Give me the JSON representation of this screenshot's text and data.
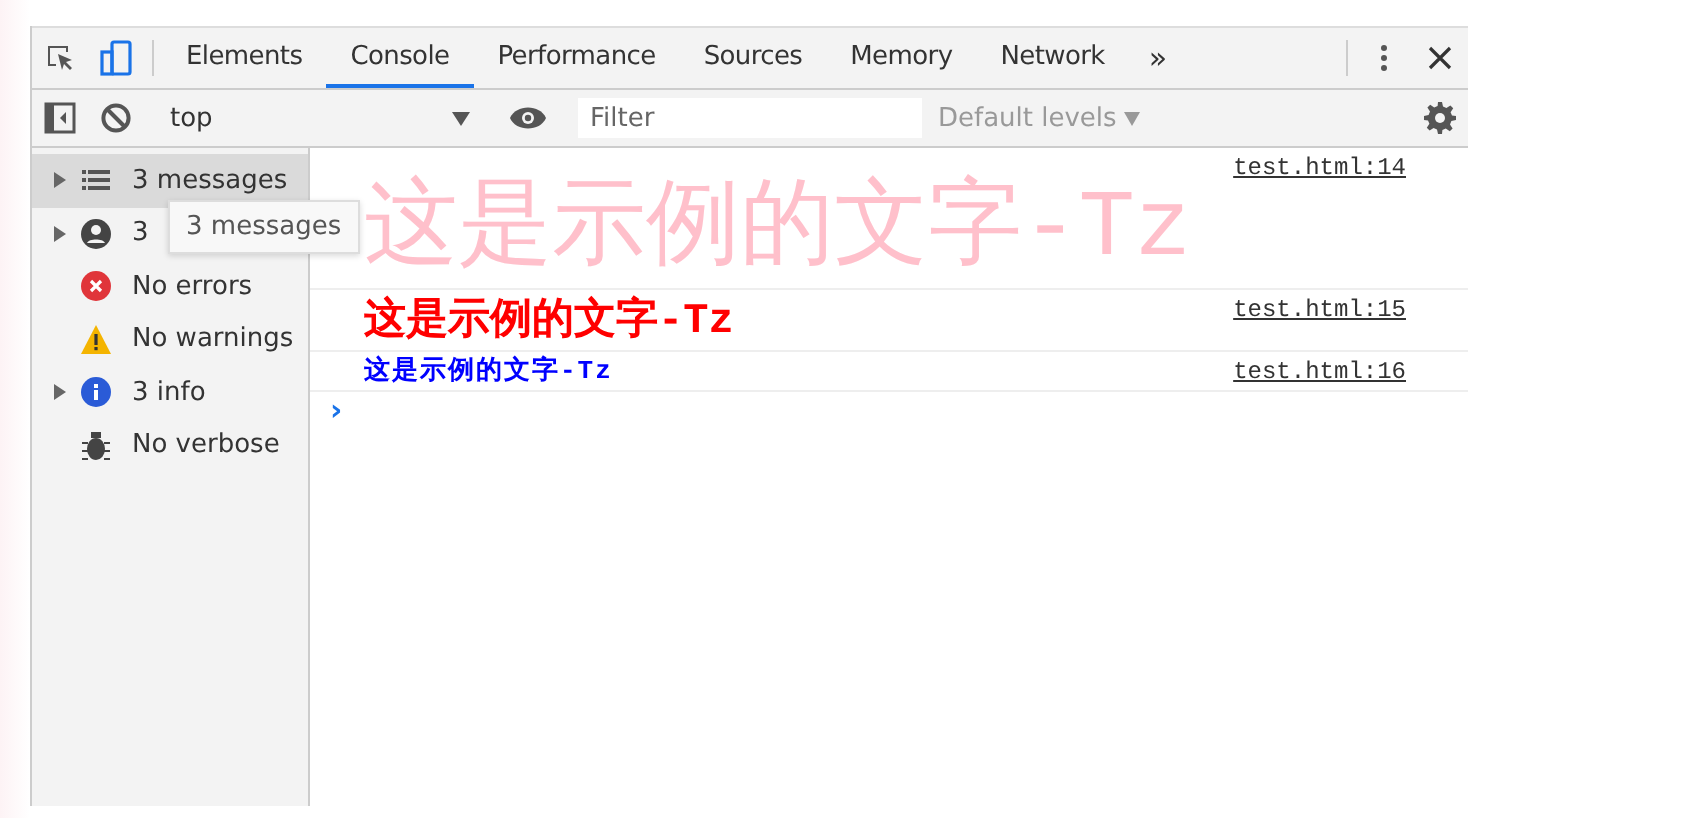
{
  "tabs": [
    {
      "label": "Elements",
      "selected": false
    },
    {
      "label": "Console",
      "selected": true
    },
    {
      "label": "Performance",
      "selected": false
    },
    {
      "label": "Sources",
      "selected": false
    },
    {
      "label": "Memory",
      "selected": false
    },
    {
      "label": "Network",
      "selected": false
    }
  ],
  "more_tabs": "»",
  "toolbar": {
    "context": "top",
    "filter": {
      "placeholder": "Filter"
    },
    "levels": "Default levels"
  },
  "sidebar": {
    "items": [
      {
        "kind": "list",
        "label": "3 messages",
        "expandable": true,
        "selected": true
      },
      {
        "kind": "user",
        "label": "3",
        "expandable": true,
        "selected": false
      },
      {
        "kind": "error",
        "label": "No errors",
        "expandable": false,
        "selected": false
      },
      {
        "kind": "warning",
        "label": "No warnings",
        "expandable": false,
        "selected": false
      },
      {
        "kind": "info",
        "label": "3 info",
        "expandable": true,
        "selected": false
      },
      {
        "kind": "verbose",
        "label": "No verbose",
        "expandable": false,
        "selected": false
      }
    ],
    "tooltip": "3 messages"
  },
  "messages": [
    {
      "kind": "large",
      "text": "这是示例的文字-Tz",
      "color": "#ffc0cb",
      "source": "test.html:14"
    },
    {
      "kind": "medium",
      "text": "这是示例的文字-Tz",
      "color": "#ff0000",
      "source": "test.html:15"
    },
    {
      "kind": "small",
      "text": "这是示例的文字-Tz",
      "color": "#0000ff",
      "source": "test.html:16"
    }
  ],
  "prompt": "›"
}
